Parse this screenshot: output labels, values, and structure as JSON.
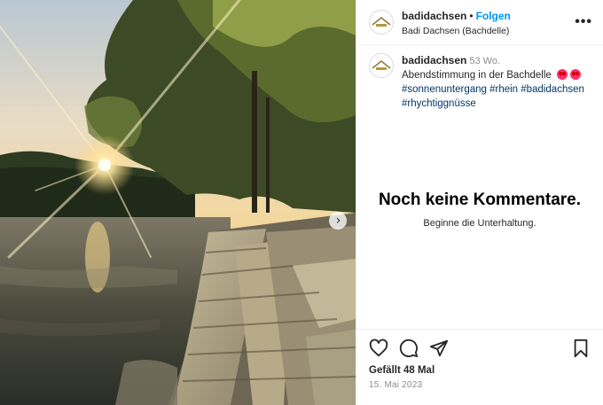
{
  "post": {
    "username": "badidachsen",
    "separator": "•",
    "follow_label": "Folgen",
    "location": "Badi Dachsen (Bachdelle)",
    "more_label": "•••",
    "next_label": "›"
  },
  "caption": {
    "username": "badidachsen",
    "age": "53 Wo.",
    "text": "Abendstimmung in der Bachdelle",
    "hashtags": "#sonnenuntergang #rhein #badidachsen #rhychtiggnüsse"
  },
  "comments": {
    "empty_title": "Noch keine Kommentare.",
    "empty_subtitle": "Beginne die Unterhaltung."
  },
  "footer": {
    "likes": "Gefällt 48 Mal",
    "date": "15. Mai 2023"
  },
  "icons": {
    "like": "heart-icon",
    "comment": "comment-icon",
    "share": "share-icon",
    "save": "bookmark-icon",
    "emoji": "heart-eyes-emoji"
  },
  "colors": {
    "link": "#0095f6",
    "hashtag": "#00376b",
    "muted": "#8e8e8e"
  }
}
